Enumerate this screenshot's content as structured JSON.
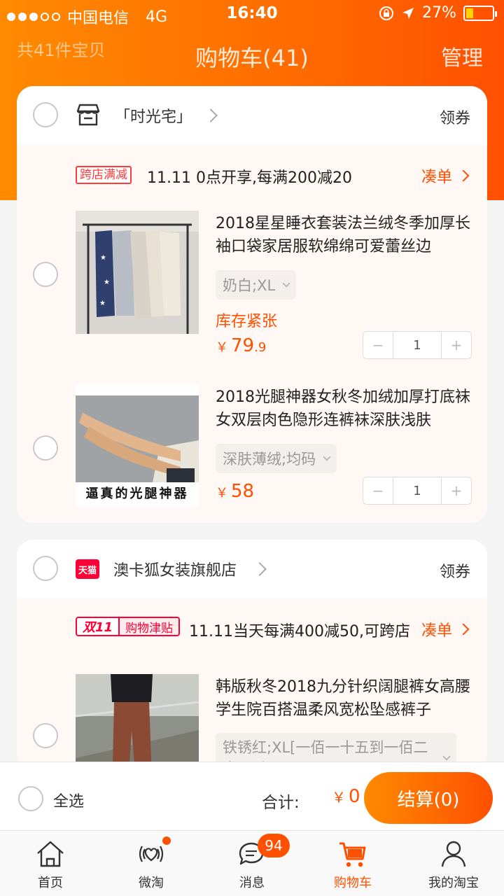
{
  "status_bar": {
    "carrier": "中国电信",
    "network": "4G",
    "time": "16:40",
    "battery": "27%",
    "battery_level": 0.27
  },
  "header": {
    "item_count": "共41件宝贝",
    "title": "购物车(41)",
    "manage": "管理"
  },
  "shops": [
    {
      "name": "「时光宅」",
      "coupon": "领券",
      "promo": {
        "tag": "跨店满减",
        "text": "11.11 0点开享,每满200减20",
        "action": "凑单"
      },
      "items": [
        {
          "title": "2018星星睡衣套装法兰绒冬季加厚长袖口袋家居服软绵绵可爱蕾丝边",
          "sku": "奶白;XL",
          "stock": "库存紧张",
          "price_symbol": "￥",
          "price_int": "79",
          "price_dec": ".9",
          "qty": "1"
        },
        {
          "title": "2018光腿神器女秋冬加绒加厚打底袜女双层肉色隐形连裤袜深肤浅肤",
          "sku": "深肤薄绒;均码",
          "price_symbol": "￥",
          "price_int": "58",
          "price_dec": "",
          "qty": "1",
          "image_caption": "逼真的光腿神器"
        }
      ]
    },
    {
      "name": "澳卡狐女装旗舰店",
      "badge": "天猫",
      "coupon": "领券",
      "promo": {
        "tag_a": "双11",
        "tag_b": "购物津贴",
        "text": "11.11当天每满400减50,可跨店",
        "action": "凑单"
      },
      "items": [
        {
          "title": "韩版秋冬2018九分针织阔腿裤女高腰学生院百搭温柔风宽松坠感裤子",
          "sku": "铁锈红;XL[一佰一十五到一佰二十五斤]"
        }
      ]
    }
  ],
  "checkout": {
    "select_all": "全选",
    "total_label": "合计:",
    "total_symbol": "￥",
    "total_value": "0",
    "settle": "结算(0)"
  },
  "tabs": [
    {
      "label": "首页",
      "icon": "home-icon"
    },
    {
      "label": "微淘",
      "icon": "weitao-icon"
    },
    {
      "label": "消息",
      "icon": "message-icon",
      "badge": "94"
    },
    {
      "label": "购物车",
      "icon": "cart-icon",
      "active": true
    },
    {
      "label": "我的淘宝",
      "icon": "profile-icon"
    }
  ],
  "colors": {
    "accent": "#ff5000",
    "header_start": "#ff8a00",
    "tmall_red": "#ff0036"
  }
}
